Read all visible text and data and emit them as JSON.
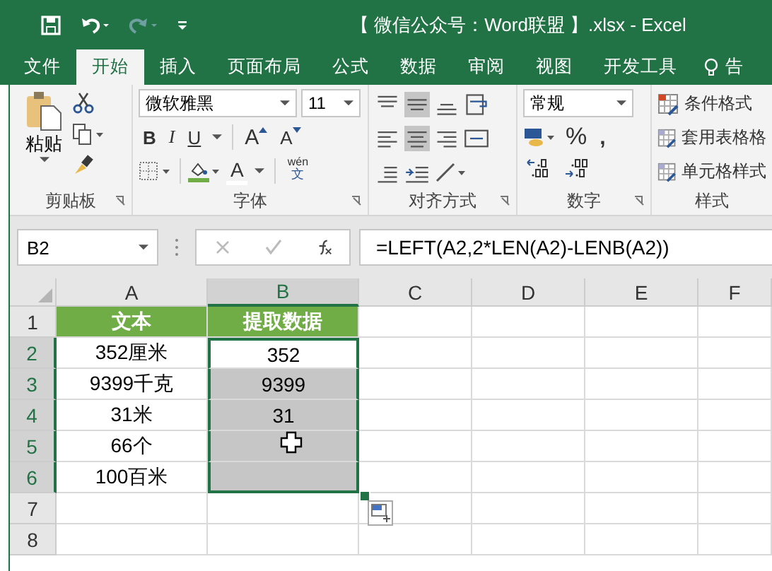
{
  "window": {
    "title": "【 微信公众号：Word联盟 】.xlsx - Excel"
  },
  "tabs": [
    {
      "label": "文件",
      "selected": false
    },
    {
      "label": "开始",
      "selected": true
    },
    {
      "label": "插入",
      "selected": false
    },
    {
      "label": "页面布局",
      "selected": false
    },
    {
      "label": "公式",
      "selected": false
    },
    {
      "label": "数据",
      "selected": false
    },
    {
      "label": "审阅",
      "selected": false
    },
    {
      "label": "视图",
      "selected": false
    },
    {
      "label": "开发工具",
      "selected": false
    }
  ],
  "tell_me": {
    "label": "告"
  },
  "ribbon": {
    "clipboard": {
      "label": "剪贴板",
      "paste": "粘贴"
    },
    "font": {
      "label": "字体",
      "font_name": "微软雅黑",
      "font_size": "11",
      "bold": "B",
      "italic": "I",
      "underline": "U",
      "grow": "A",
      "shrink": "A",
      "font_color": "A",
      "phonetic_top": "wén",
      "phonetic_bottom": "文"
    },
    "alignment": {
      "label": "对齐方式"
    },
    "number": {
      "label": "数字",
      "format": "常规",
      "percent": "%",
      "comma": ","
    },
    "styles": {
      "label": "样式",
      "items": [
        "条件格式",
        "套用表格格",
        "单元格样式"
      ]
    }
  },
  "formula_bar": {
    "name_box": "B2",
    "formula": "=LEFT(A2,2*LEN(A2)-LENB(A2))"
  },
  "sheet": {
    "columns": [
      {
        "label": "A",
        "selected": false
      },
      {
        "label": "B",
        "selected": true
      },
      {
        "label": "C",
        "selected": false
      },
      {
        "label": "D",
        "selected": false
      },
      {
        "label": "E",
        "selected": false
      },
      {
        "label": "F",
        "selected": false
      }
    ],
    "rows": [
      {
        "label": "1",
        "selected": false,
        "cells": [
          {
            "text": "文本",
            "kind": "header",
            "selected": false,
            "active": false
          },
          {
            "text": "提取数据",
            "kind": "header",
            "selected": false,
            "active": false
          }
        ]
      },
      {
        "label": "2",
        "selected": true,
        "cells": [
          {
            "text": "352厘米",
            "kind": "value",
            "selected": false,
            "active": false
          },
          {
            "text": "352",
            "kind": "value",
            "selected": true,
            "active": true
          }
        ]
      },
      {
        "label": "3",
        "selected": true,
        "cells": [
          {
            "text": "9399千克",
            "kind": "value",
            "selected": false,
            "active": false
          },
          {
            "text": "9399",
            "kind": "value",
            "selected": true,
            "active": false
          }
        ]
      },
      {
        "label": "4",
        "selected": true,
        "cells": [
          {
            "text": "31米",
            "kind": "value",
            "selected": false,
            "active": false
          },
          {
            "text": "31",
            "kind": "value",
            "selected": true,
            "active": false
          }
        ]
      },
      {
        "label": "5",
        "selected": true,
        "cells": [
          {
            "text": "66个",
            "kind": "value",
            "selected": false,
            "active": false
          },
          {
            "kind": "value",
            "selected": true,
            "active": false
          }
        ]
      },
      {
        "label": "6",
        "selected": true,
        "cells": [
          {
            "text": "100百米",
            "kind": "value",
            "selected": false,
            "active": false
          },
          {
            "kind": "value",
            "selected": true,
            "active": false
          }
        ]
      },
      {
        "label": "7",
        "selected": false,
        "cells": []
      },
      {
        "label": "8",
        "selected": false,
        "cells": []
      }
    ]
  }
}
